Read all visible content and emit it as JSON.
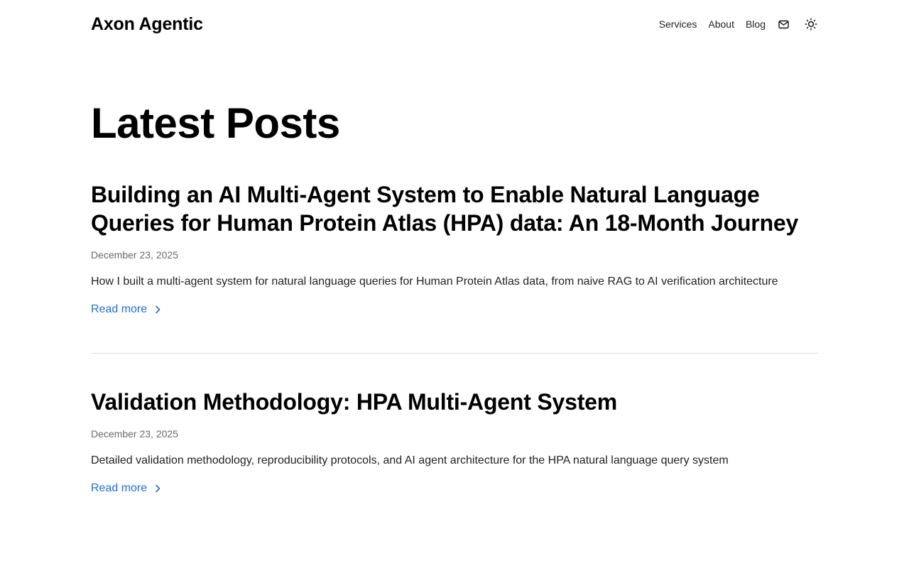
{
  "header": {
    "brand": "Axon Agentic",
    "nav": [
      {
        "label": "Services"
      },
      {
        "label": "About"
      },
      {
        "label": "Blog"
      }
    ],
    "icons": [
      "mail-icon",
      "sun-icon"
    ]
  },
  "main": {
    "title": "Latest Posts",
    "posts": [
      {
        "title": "Building an AI Multi-Agent System to Enable Natural Language Queries for Human Protein Atlas (HPA) data: An 18-Month Journey",
        "date": "December 23, 2025",
        "description": "How I built a multi-agent system for natural language queries for Human Protein Atlas data, from naive RAG to AI verification architecture",
        "read_more": "Read more"
      },
      {
        "title": "Validation Methodology: HPA Multi-Agent System",
        "date": "December 23, 2025",
        "description": "Detailed validation methodology, reproducibility protocols, and AI agent architecture for the HPA natural language query system",
        "read_more": "Read more"
      }
    ]
  },
  "colors": {
    "link": "#1a6fd6",
    "text": "#111111",
    "muted": "#6b6b6b",
    "divider": "#dcdcdc"
  }
}
